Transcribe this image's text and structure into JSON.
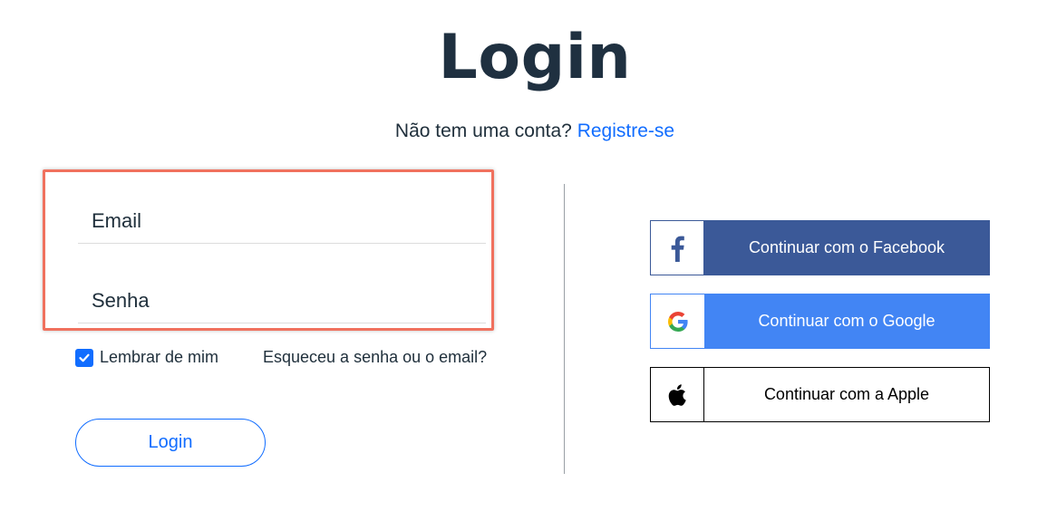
{
  "page": {
    "title": "Login",
    "signup_prompt": "Não tem uma conta?",
    "signup_link": "Registre-se"
  },
  "form": {
    "email_placeholder": "Email",
    "password_placeholder": "Senha",
    "remember_label": "Lembrar de mim",
    "remember_checked": true,
    "forgot_link": "Esqueceu a senha ou o email?",
    "login_button": "Login"
  },
  "social": {
    "facebook": {
      "label": "Continuar com o Facebook",
      "icon": "facebook-icon",
      "color": "#3b5998"
    },
    "google": {
      "label": "Continuar com o Google",
      "icon": "google-icon",
      "color": "#4285f4"
    },
    "apple": {
      "label": "Continuar com a Apple",
      "icon": "apple-icon",
      "color": "#000000"
    }
  },
  "colors": {
    "accent": "#116dff",
    "highlight_border": "#f0715e",
    "text": "#20303c"
  }
}
